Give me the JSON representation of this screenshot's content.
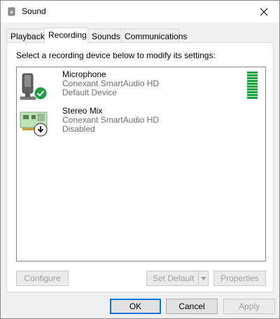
{
  "window": {
    "title": "Sound"
  },
  "tabs": [
    {
      "label": "Playback"
    },
    {
      "label": "Recording"
    },
    {
      "label": "Sounds"
    },
    {
      "label": "Communications"
    }
  ],
  "panel": {
    "instruction": "Select a recording device below to modify its settings:",
    "devices": [
      {
        "name": "Microphone",
        "driver": "Conexant SmartAudio HD",
        "status": "Default Device",
        "icon": "microphone-icon",
        "badge": "green-check-icon",
        "level_active_bars": 10
      },
      {
        "name": "Stereo Mix",
        "driver": "Conexant SmartAudio HD",
        "status": "Disabled",
        "icon": "sound-card-icon",
        "badge": "disabled-arrow-icon"
      }
    ],
    "buttons": {
      "configure": "Configure",
      "set_default": "Set Default",
      "properties": "Properties"
    }
  },
  "footer": {
    "ok": "OK",
    "cancel": "Cancel",
    "apply": "Apply"
  },
  "colors": {
    "accent": "#0078d7",
    "level": "#0fa53a",
    "check": "#1e9c3e"
  }
}
